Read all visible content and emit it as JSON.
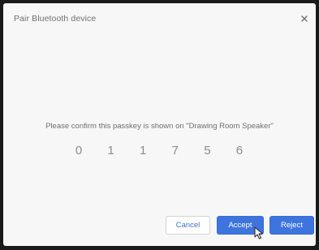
{
  "dialog": {
    "title": "Pair Bluetooth device",
    "close_icon": "close-icon",
    "prompt": "Please confirm this passkey is shown on \"Drawing Room Speaker\"",
    "passkey_digits": [
      "0",
      "1",
      "1",
      "7",
      "5",
      "6"
    ]
  },
  "buttons": {
    "cancel": "Cancel",
    "accept": "Accept",
    "reject": "Reject"
  },
  "colors": {
    "dialog_background": "#f7f7f7",
    "primary_button": "#3e74de",
    "cancel_text": "#3f6fd0"
  },
  "cursor_icon": "mouse-pointer-icon"
}
